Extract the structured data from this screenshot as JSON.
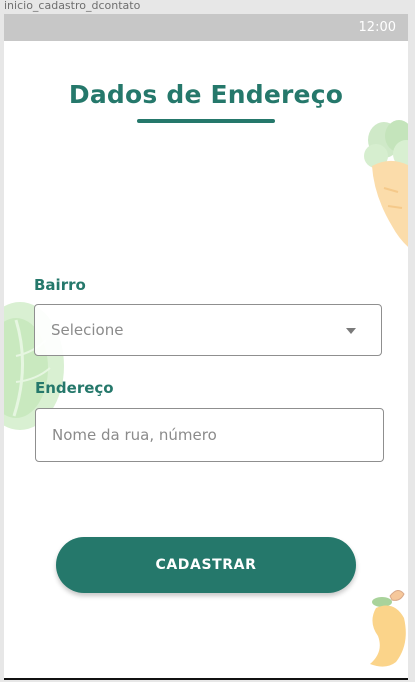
{
  "artboard_name": "inicio_cadastro_dcontato",
  "status_bar": {
    "time": "12:00"
  },
  "page": {
    "title": "Dados de Endereço"
  },
  "form": {
    "neighborhood": {
      "label": "Bairro",
      "selected_value": "Selecione"
    },
    "address": {
      "label": "Endereço",
      "value": "",
      "placeholder": "Nome da rua, número"
    },
    "submit_label": "CADASTRAR"
  },
  "colors": {
    "primary": "#25786b",
    "status_bar": "#c7c7c7",
    "background": "#ffffff"
  },
  "icons": {
    "select_chevron": "chevron-down-icon",
    "decorations": [
      "carrot-icon",
      "cabbage-icon",
      "mango-icon"
    ]
  }
}
